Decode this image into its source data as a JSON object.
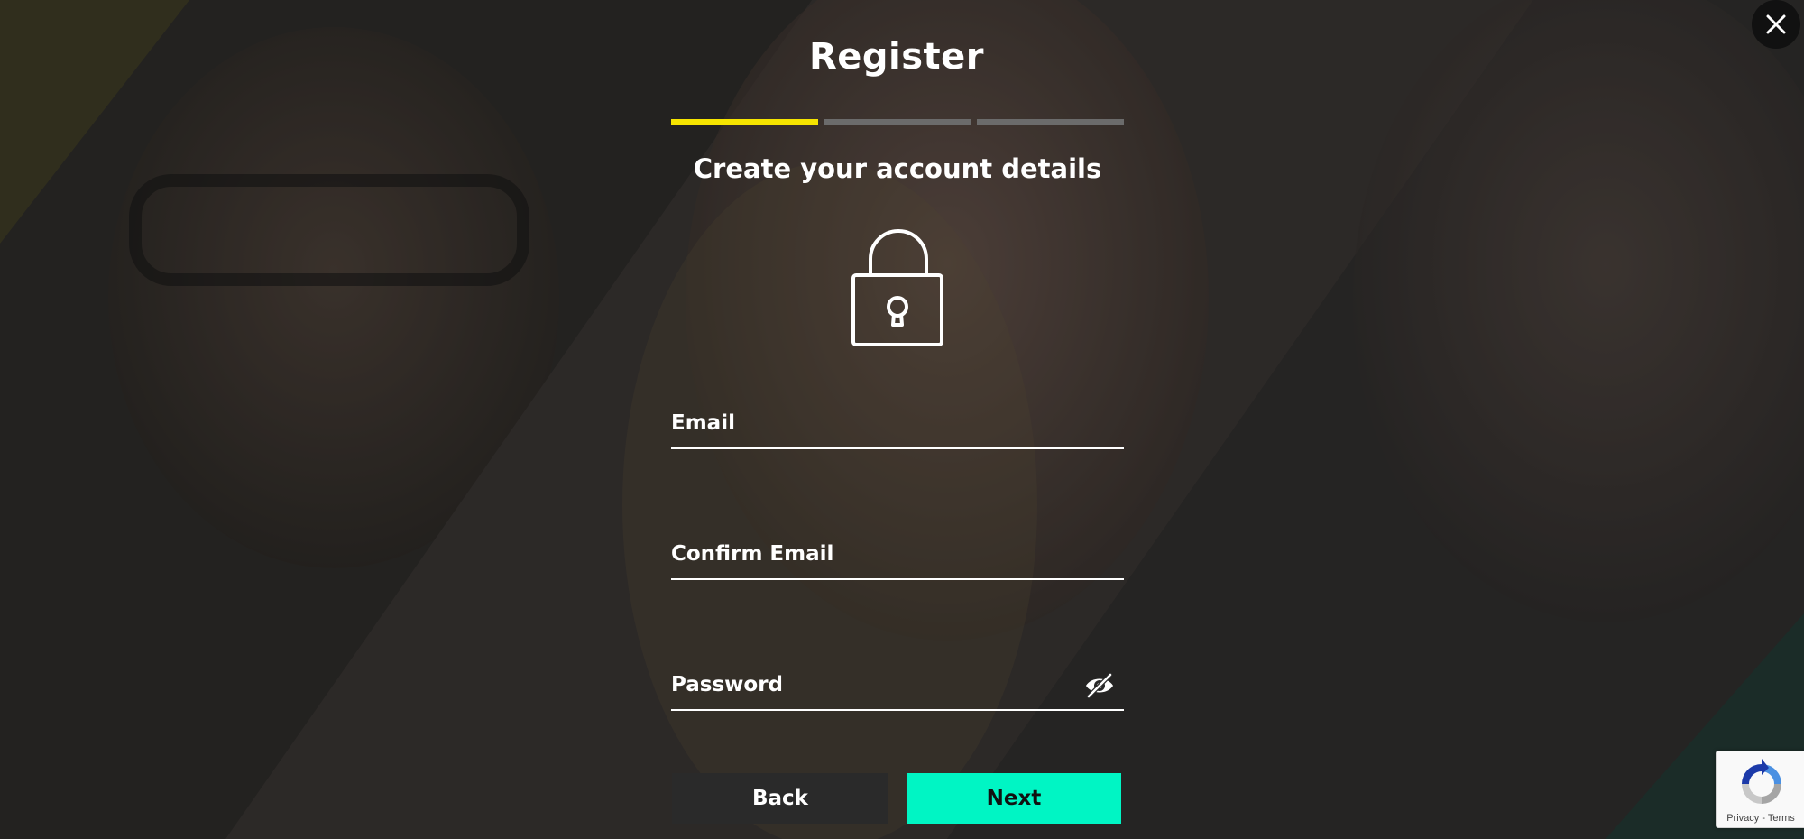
{
  "header": {
    "title": "Register",
    "close_icon": "close-icon"
  },
  "progress": {
    "current_step": 1,
    "total_steps": 3
  },
  "step": {
    "subtitle": "Create your account details",
    "illustration": "lock-icon"
  },
  "form": {
    "email_label": "Email",
    "confirm_email_label": "Confirm Email",
    "password_label": "Password",
    "password_toggle_icon": "eye-off-icon"
  },
  "actions": {
    "back_label": "Back",
    "next_label": "Next"
  },
  "recaptcha": {
    "privacy": "Privacy",
    "separator": "-",
    "terms": "Terms"
  },
  "colors": {
    "accent_progress": "#f5e400",
    "next_button": "#00f5c4",
    "back_button": "#2a2a2a"
  }
}
